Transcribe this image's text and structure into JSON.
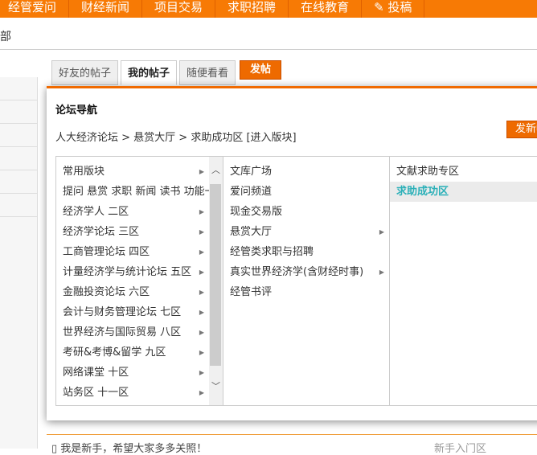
{
  "topnav": [
    "经管爱问",
    "财经新闻",
    "项目交易",
    "求职招聘",
    "在线教育",
    "投稿"
  ],
  "sub_text": "部",
  "tabs": [
    "好友的帖子",
    "我的帖子",
    "随便看看"
  ],
  "post_button": "发帖",
  "dialog": {
    "title": "论坛导航",
    "breadcrumb": "人大经济论坛 > 悬赏大厅 > 求助成功区 [进入版块]",
    "new_button": "发新帖",
    "col1": [
      {
        "label": "常用版块",
        "arrow": true
      },
      {
        "label": "提问 悬赏 求职 新闻 读书 功能一区",
        "arrow": false
      },
      {
        "label": "经济学人 二区",
        "arrow": true
      },
      {
        "label": "经济学论坛 三区",
        "arrow": true
      },
      {
        "label": "工商管理论坛 四区",
        "arrow": true
      },
      {
        "label": "计量经济学与统计论坛 五区",
        "arrow": true
      },
      {
        "label": "金融投资论坛 六区",
        "arrow": true
      },
      {
        "label": "会计与财务管理论坛 七区",
        "arrow": true
      },
      {
        "label": "世界经济与国际贸易 八区",
        "arrow": true
      },
      {
        "label": "考研&考博&留学 九区",
        "arrow": true
      },
      {
        "label": "网络课堂 十区",
        "arrow": true
      },
      {
        "label": "站务区 十一区",
        "arrow": true
      }
    ],
    "col2": [
      {
        "label": "文库广场",
        "arrow": false
      },
      {
        "label": "爱问频道",
        "arrow": false
      },
      {
        "label": "现金交易版",
        "arrow": false
      },
      {
        "label": "悬赏大厅",
        "arrow": true
      },
      {
        "label": "经管类求职与招聘",
        "arrow": false
      },
      {
        "label": "真实世界经济学(含财经时事)",
        "arrow": true
      },
      {
        "label": "经管书评",
        "arrow": false
      }
    ],
    "col3": [
      {
        "label": "文献求助专区",
        "selected": false
      },
      {
        "label": "求助成功区",
        "selected": true
      }
    ]
  },
  "behind": {
    "row_title": "我是新手，希望大家多多关照！",
    "row_forum": "新手入门区"
  },
  "colors": {
    "accent": "#f77a05",
    "selected_text": "#2bb0b8"
  }
}
